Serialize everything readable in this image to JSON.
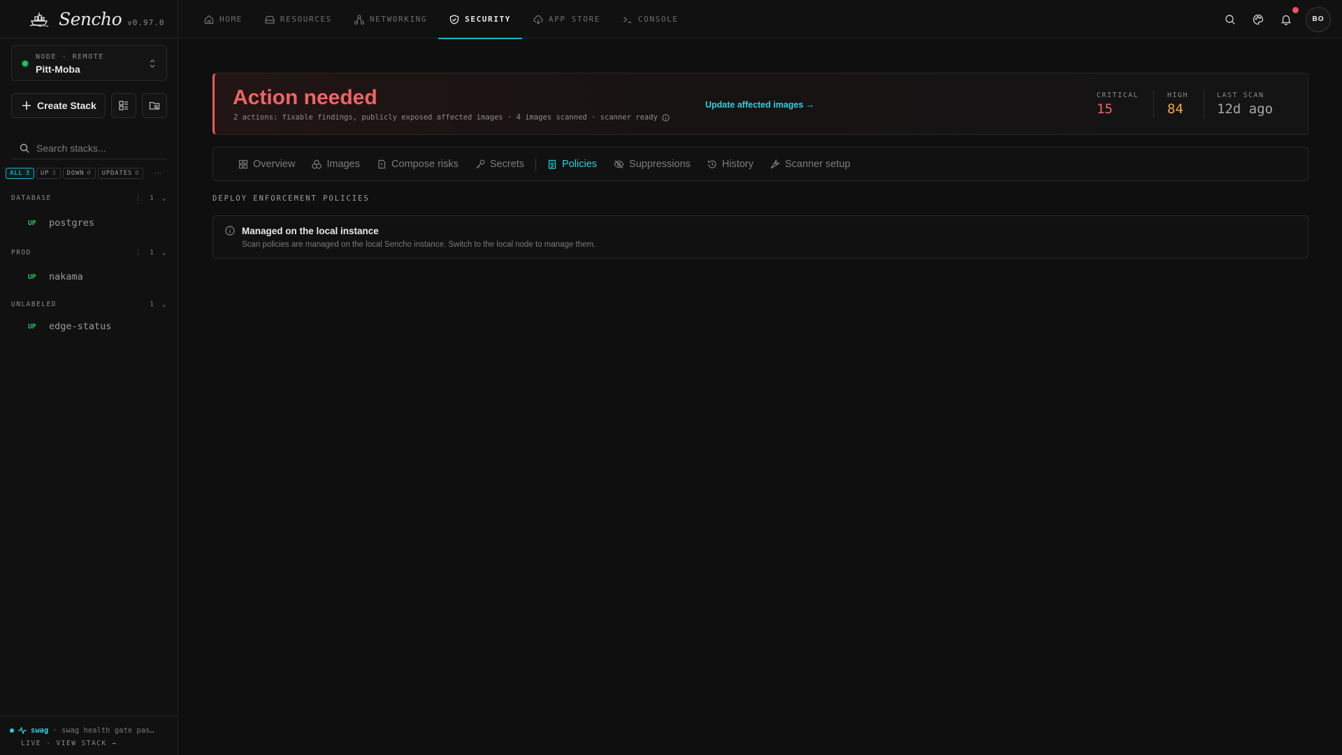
{
  "app": {
    "name": "Sencho",
    "version": "v0.97.0"
  },
  "node": {
    "meta": "NODE · REMOTE",
    "name": "Pitt-Moba",
    "status_color": "#22c55e"
  },
  "sidebar": {
    "create_label": "Create Stack",
    "search_placeholder": "Search stacks...",
    "filters": [
      {
        "label": "ALL",
        "count": "3",
        "active": true
      },
      {
        "label": "UP",
        "count": "3"
      },
      {
        "label": "DOWN",
        "count": "0"
      },
      {
        "label": "UPDATES",
        "count": "0"
      }
    ],
    "more": "···",
    "groups": [
      {
        "name": "DATABASE",
        "count": "1",
        "stacks": [
          {
            "status": "UP",
            "name": "postgres"
          }
        ]
      },
      {
        "name": "PROD",
        "count": "1",
        "stacks": [
          {
            "status": "UP",
            "name": "nakama"
          }
        ]
      },
      {
        "name": "UNLABELED",
        "count": "1",
        "stacks": [
          {
            "status": "UP",
            "name": "edge-status"
          }
        ]
      }
    ],
    "footer": {
      "stack": "swag",
      "message": "· swag health gate pas…",
      "link": "LIVE · VIEW STACK →"
    }
  },
  "nav": {
    "tabs": [
      "HOME",
      "RESOURCES",
      "NETWORKING",
      "SECURITY",
      "APP STORE",
      "CONSOLE"
    ],
    "active": "SECURITY",
    "avatar": "BO"
  },
  "alert": {
    "title": "Action needed",
    "subtitle": "2 actions: fixable findings, publicly exposed affected images · 4 images scanned · scanner ready",
    "link": "Update affected images →",
    "stats": [
      {
        "label": "CRITICAL",
        "value": "15",
        "color": "#f06464"
      },
      {
        "label": "HIGH",
        "value": "84",
        "color": "#f5a94a"
      },
      {
        "label": "LAST SCAN",
        "value": "12d ago",
        "color": "#a8a8a8"
      }
    ]
  },
  "subtabs": [
    "Overview",
    "Images",
    "Compose risks",
    "Secrets",
    "Policies",
    "Suppressions",
    "History",
    "Scanner setup"
  ],
  "active_subtab": "Policies",
  "section": {
    "label": "DEPLOY ENFORCEMENT POLICIES"
  },
  "info": {
    "title": "Managed on the local instance",
    "description": "Scan policies are managed on the local Sencho instance. Switch to the local node to manage them."
  },
  "colors": {
    "accent": "#1fb5c9",
    "danger": "#f06464",
    "warning": "#f5a94a",
    "ok": "#22c55e"
  }
}
